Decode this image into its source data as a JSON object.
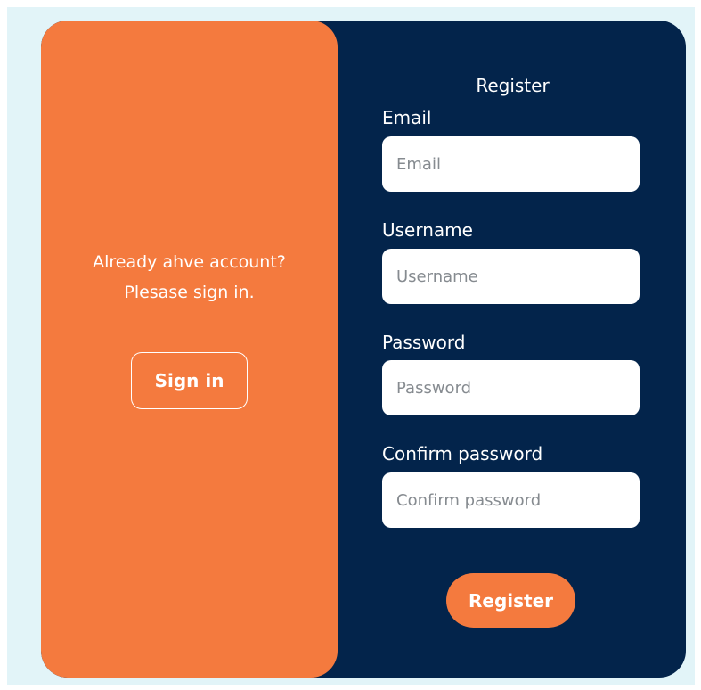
{
  "colors": {
    "background": "#e2f4f8",
    "card": "#03244b",
    "accent": "#f47a3e",
    "text": "#ffffff"
  },
  "sign_in_panel": {
    "line1": "Already ahve account?",
    "line2": "Plesase sign in.",
    "button_label": "Sign in"
  },
  "register_form": {
    "title": "Register",
    "fields": [
      {
        "label": "Email",
        "placeholder": "Email",
        "value": ""
      },
      {
        "label": "Username",
        "placeholder": "Username",
        "value": ""
      },
      {
        "label": "Password",
        "placeholder": "Password",
        "value": ""
      },
      {
        "label": "Confirm password",
        "placeholder": "Confirm password",
        "value": ""
      }
    ],
    "button_label": "Register"
  }
}
